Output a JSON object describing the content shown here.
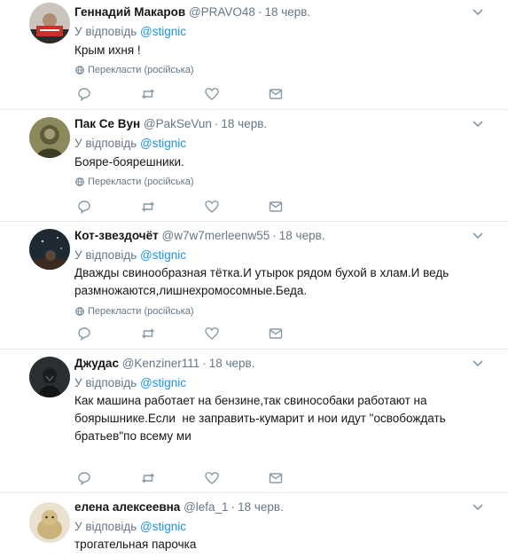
{
  "labels": {
    "reply_prefix": "У відповідь",
    "translate": "Перекласти (російська)"
  },
  "colors": {
    "link": "#1b95e0",
    "muted": "#657786",
    "divider": "#e6ecf0"
  },
  "tweets": [
    {
      "name": "Геннадий Макаров",
      "handle": "@PRAVO48",
      "date": "18 черв.",
      "reply_to": "@stignic",
      "text": "Крым ихня !",
      "avatar_icon": "avatar-photo"
    },
    {
      "name": "Пак Се Вун",
      "handle": "@PakSeVun",
      "date": "18 черв.",
      "reply_to": "@stignic",
      "text": "Бояре-боярешники.",
      "avatar_icon": "avatar-photo"
    },
    {
      "name": "Кот-звездочёт",
      "handle": "@w7w7merleenw55",
      "date": "18 черв.",
      "reply_to": "@stignic",
      "text": "Дважды свинообразная тётка.И утырок рядом бухой в хлам.И ведь\nразмножаются,лишнехромосомные.Беда.",
      "avatar_icon": "avatar-photo"
    },
    {
      "name": "Джудас",
      "handle": "@Kenziner111",
      "date": "18 черв.",
      "reply_to": "@stignic",
      "text": "Как машина работает на бензине,так свинособаки работают на\nбоярышнике.Если  не заправить-кумарит и нои идут \"освобождать\nбратьев\"по всему ми",
      "avatar_icon": "avatar-photo"
    },
    {
      "name": "елена алексеевна",
      "handle": "@lefa_1",
      "date": "18 черв.",
      "reply_to": "@stignic",
      "text": "трогательная парочка",
      "avatar_icon": "avatar-photo"
    }
  ]
}
